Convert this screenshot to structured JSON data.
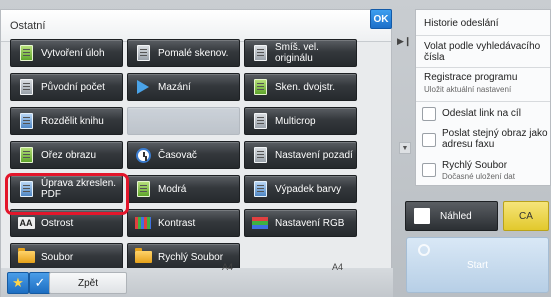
{
  "panel": {
    "title": "Ostatní",
    "ok_label": "OK"
  },
  "buttons": [
    {
      "label": "Vytvoření úloh",
      "icon": "job-build-icon",
      "enabled": true
    },
    {
      "label": "Pomalé skenov.",
      "icon": "slow-scan-icon",
      "enabled": true
    },
    {
      "label": "Smíš. vel. originálu",
      "icon": "mixed-size-icon",
      "enabled": true
    },
    {
      "label": "Původní počet",
      "icon": "original-count-icon",
      "enabled": true
    },
    {
      "label": "Mazání",
      "icon": "erase-icon",
      "enabled": true
    },
    {
      "label": "Sken. dvojstr.",
      "icon": "duplex-scan-icon",
      "enabled": true
    },
    {
      "label": "Rozdělit knihu",
      "icon": "book-divide-icon",
      "enabled": true
    },
    {
      "label": "",
      "icon": "disabled-icon",
      "enabled": false
    },
    {
      "label": "Multicrop",
      "icon": "multicrop-icon",
      "enabled": true
    },
    {
      "label": "Ořez obrazu",
      "icon": "image-crop-icon",
      "enabled": true
    },
    {
      "label": "Časovač",
      "icon": "timer-icon",
      "enabled": true
    },
    {
      "label": "Nastavení pozadí",
      "icon": "background-icon",
      "enabled": true
    },
    {
      "label": "Úprava zkreslen. PDF",
      "icon": "pdf-skew-icon",
      "enabled": true
    },
    {
      "label": "Modrá",
      "icon": "blue-icon",
      "enabled": true
    },
    {
      "label": "Výpadek barvy",
      "icon": "color-dropout-icon",
      "enabled": true
    },
    {
      "label": "Ostrost",
      "icon": "sharpness-icon",
      "enabled": true
    },
    {
      "label": "Kontrast",
      "icon": "contrast-icon",
      "enabled": true
    },
    {
      "label": "Nastavení RGB",
      "icon": "rgb-icon",
      "enabled": true
    },
    {
      "label": "Soubor",
      "icon": "file-icon",
      "enabled": true
    },
    {
      "label": "Rychlý Soubor",
      "icon": "quick-file-icon",
      "enabled": true
    }
  ],
  "bottom": {
    "back_label": "Zpět",
    "paper_left": "A4",
    "paper_right": "A4"
  },
  "right_panel": {
    "history": "Historie odeslání",
    "call_by_number": "Volat podle vyhledávacího čísla",
    "register_program": "Registrace programu",
    "register_program_sub": "Uložit aktuální nastavení",
    "send_link": "Odeslat link na cíl",
    "send_same_image": "Poslat stejný obraz jako adresu faxu",
    "quick_file": "Rychlý Soubor",
    "quick_file_sub": "Dočasné uložení dat"
  },
  "actions": {
    "preview": "Náhled",
    "ca": "CA",
    "start": "Start"
  }
}
